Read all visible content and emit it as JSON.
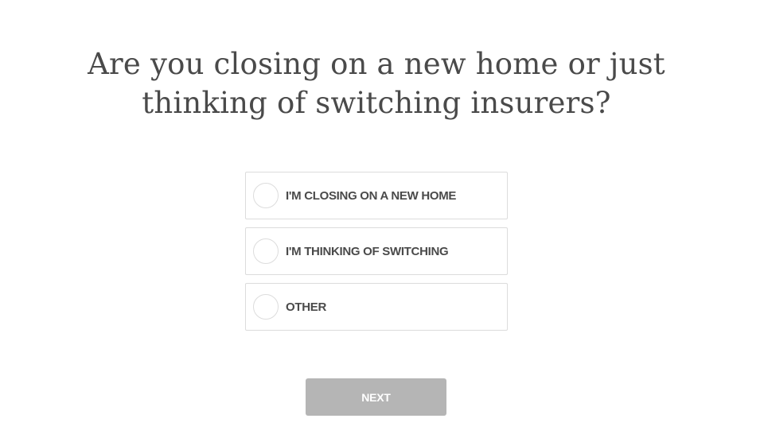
{
  "question": {
    "line1": "Are you closing on a new home or just",
    "line2": "thinking of switching insurers?"
  },
  "options": [
    {
      "label": "I'M CLOSING ON A NEW HOME",
      "selected": false
    },
    {
      "label": "I'M THINKING OF SWITCHING",
      "selected": false
    },
    {
      "label": "OTHER",
      "selected": false
    }
  ],
  "next_button": {
    "label": "NEXT",
    "enabled": false
  },
  "colors": {
    "text": "#4a4a4a",
    "border": "#dcdcdc",
    "button_disabled": "#b5b5b5",
    "button_text": "#ffffff",
    "background": "#ffffff"
  }
}
